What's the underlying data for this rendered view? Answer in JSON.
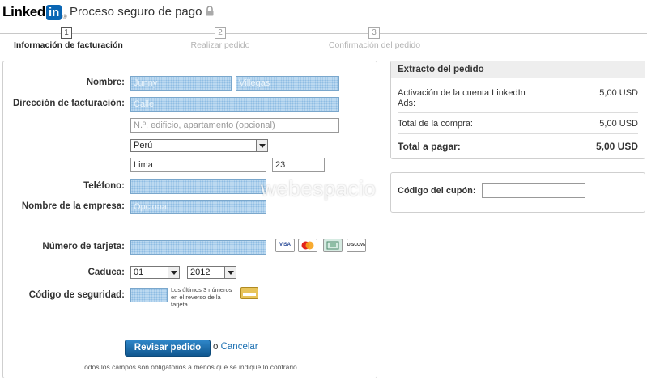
{
  "header": {
    "logo_text": "Linked",
    "logo_in": "in",
    "logo_reg": "®",
    "title": "Proceso seguro de pago"
  },
  "steps": [
    {
      "number": "1",
      "label": "Información de facturación",
      "active": true
    },
    {
      "number": "2",
      "label": "Realizar pedido",
      "active": false
    },
    {
      "number": "3",
      "label": "Confirmación del pedido",
      "active": false
    }
  ],
  "billing": {
    "name_label": "Nombre:",
    "first_name_value": "Junny",
    "last_name_value": "Villegas",
    "address_label": "Dirección de facturación:",
    "street_placeholder": "Calle",
    "address2_placeholder": "N.º, edificio, apartamento (opcional)",
    "country_value": "Perú",
    "city_value": "Lima",
    "postal_value": "23",
    "phone_label": "Teléfono:",
    "phone_value": "",
    "company_label": "Nombre de la empresa:",
    "company_placeholder": "Opcional"
  },
  "payment": {
    "card_label": "Número de tarjeta:",
    "card_value": "",
    "card_icons": [
      "visa-icon",
      "mastercard-icon",
      "amex-icon",
      "discover-icon"
    ],
    "visa_text": "VISA",
    "discover_text": "DISCOVER",
    "expiry_label": "Caduca:",
    "expiry_month": "01",
    "expiry_year": "2012",
    "cvv_label": "Código de seguridad:",
    "cvv_note": "Los últimos 3 números en el reverso de la tarjeta"
  },
  "actions": {
    "review_button": "Revisar pedido",
    "or_text": "o",
    "cancel_link": "Cancelar",
    "required_note": "Todos los campos son obligatorios a menos que se indique lo contrario."
  },
  "summary": {
    "title": "Extracto del pedido",
    "item_label": "Activación de la cuenta LinkedIn Ads:",
    "item_value": "5,00 USD",
    "subtotal_label": "Total de la compra:",
    "subtotal_value": "5,00 USD",
    "total_label": "Total a pagar:",
    "total_value": "5,00 USD"
  },
  "coupon": {
    "label": "Código del cupón:",
    "value": ""
  },
  "watermark": "webespacio",
  "colors": {
    "brand_blue": "#0a66b4",
    "button_blue": "#1a6fb2",
    "field_highlight": "#bcd9f0"
  }
}
